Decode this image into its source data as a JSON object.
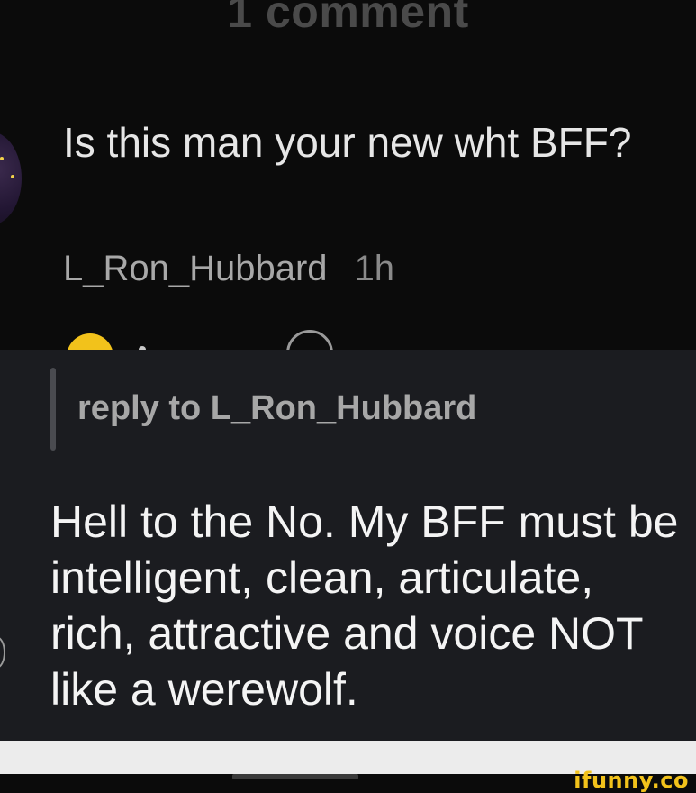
{
  "header": {
    "title": "1 comment"
  },
  "comment": {
    "text": "Is this man your new wht BFF?",
    "author": "L_Ron_Hubbard",
    "time": "1h"
  },
  "reply": {
    "reply_to": "reply to L_Ron_Hubbard",
    "text": "Hell to the No. My BFF must be intelligent, clean, articulate, rich, attractive and voice NOT like a werewolf."
  },
  "watermark": {
    "text": "ifunny.co"
  },
  "colors": {
    "background": "#0b0b0b",
    "reply_panel": "#1b1c20",
    "accent_yellow": "#f2c21b"
  }
}
